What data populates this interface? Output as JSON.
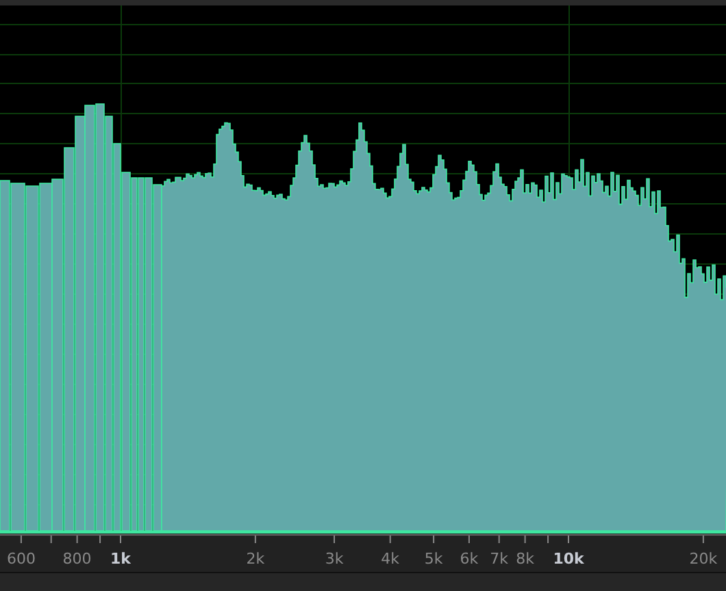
{
  "frequency_axis": {
    "labels": [
      {
        "text": "600",
        "kind": "minor"
      },
      {
        "text": "800",
        "kind": "minor"
      },
      {
        "text": "1k",
        "kind": "major"
      },
      {
        "text": "2k",
        "kind": "minor"
      },
      {
        "text": "3k",
        "kind": "minor"
      },
      {
        "text": "4k",
        "kind": "minor"
      },
      {
        "text": "5k",
        "kind": "minor"
      },
      {
        "text": "6k",
        "kind": "minor"
      },
      {
        "text": "7k",
        "kind": "minor"
      },
      {
        "text": "8k",
        "kind": "minor"
      },
      {
        "text": "10k",
        "kind": "major"
      },
      {
        "text": "20k",
        "kind": "minor"
      }
    ]
  }
}
